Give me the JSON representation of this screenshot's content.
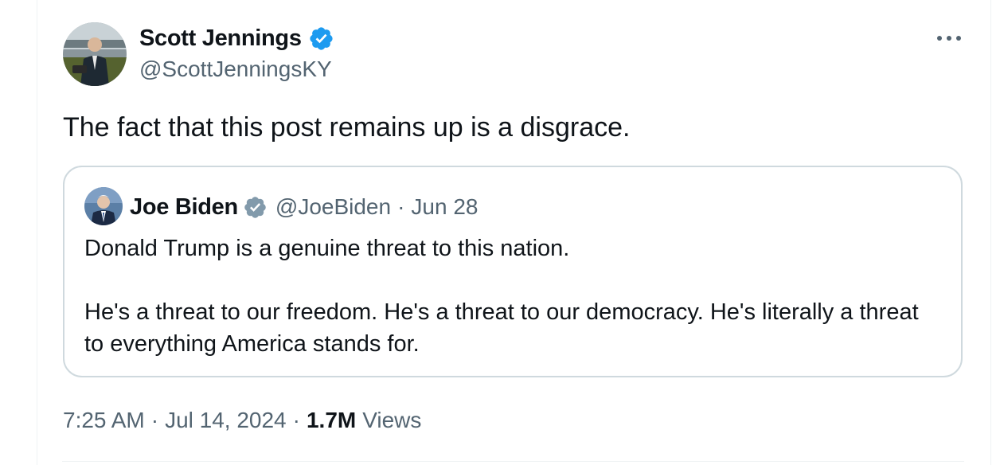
{
  "tweet": {
    "author": {
      "display_name": "Scott Jennings",
      "handle": "@ScottJenningsKY",
      "verified_badge_color": "#1d9bf0"
    },
    "text": "The fact that this post remains up is a disgrace.",
    "quoted": {
      "author": {
        "display_name": "Joe Biden",
        "handle": "@JoeBiden",
        "verified_badge_color": "#829aab"
      },
      "separator": "·",
      "date": "Jun 28",
      "paragraphs": [
        "Donald Trump is a genuine threat to this nation.",
        "He's a threat to our freedom. He's a threat to our democracy. He's literally a threat to everything America stands for."
      ]
    },
    "meta": {
      "time": "7:25 AM",
      "separator": "·",
      "date": "Jul 14, 2024",
      "views_count": "1.7M",
      "views_label": "Views"
    },
    "more_icon": "more-horizontal-icon"
  }
}
